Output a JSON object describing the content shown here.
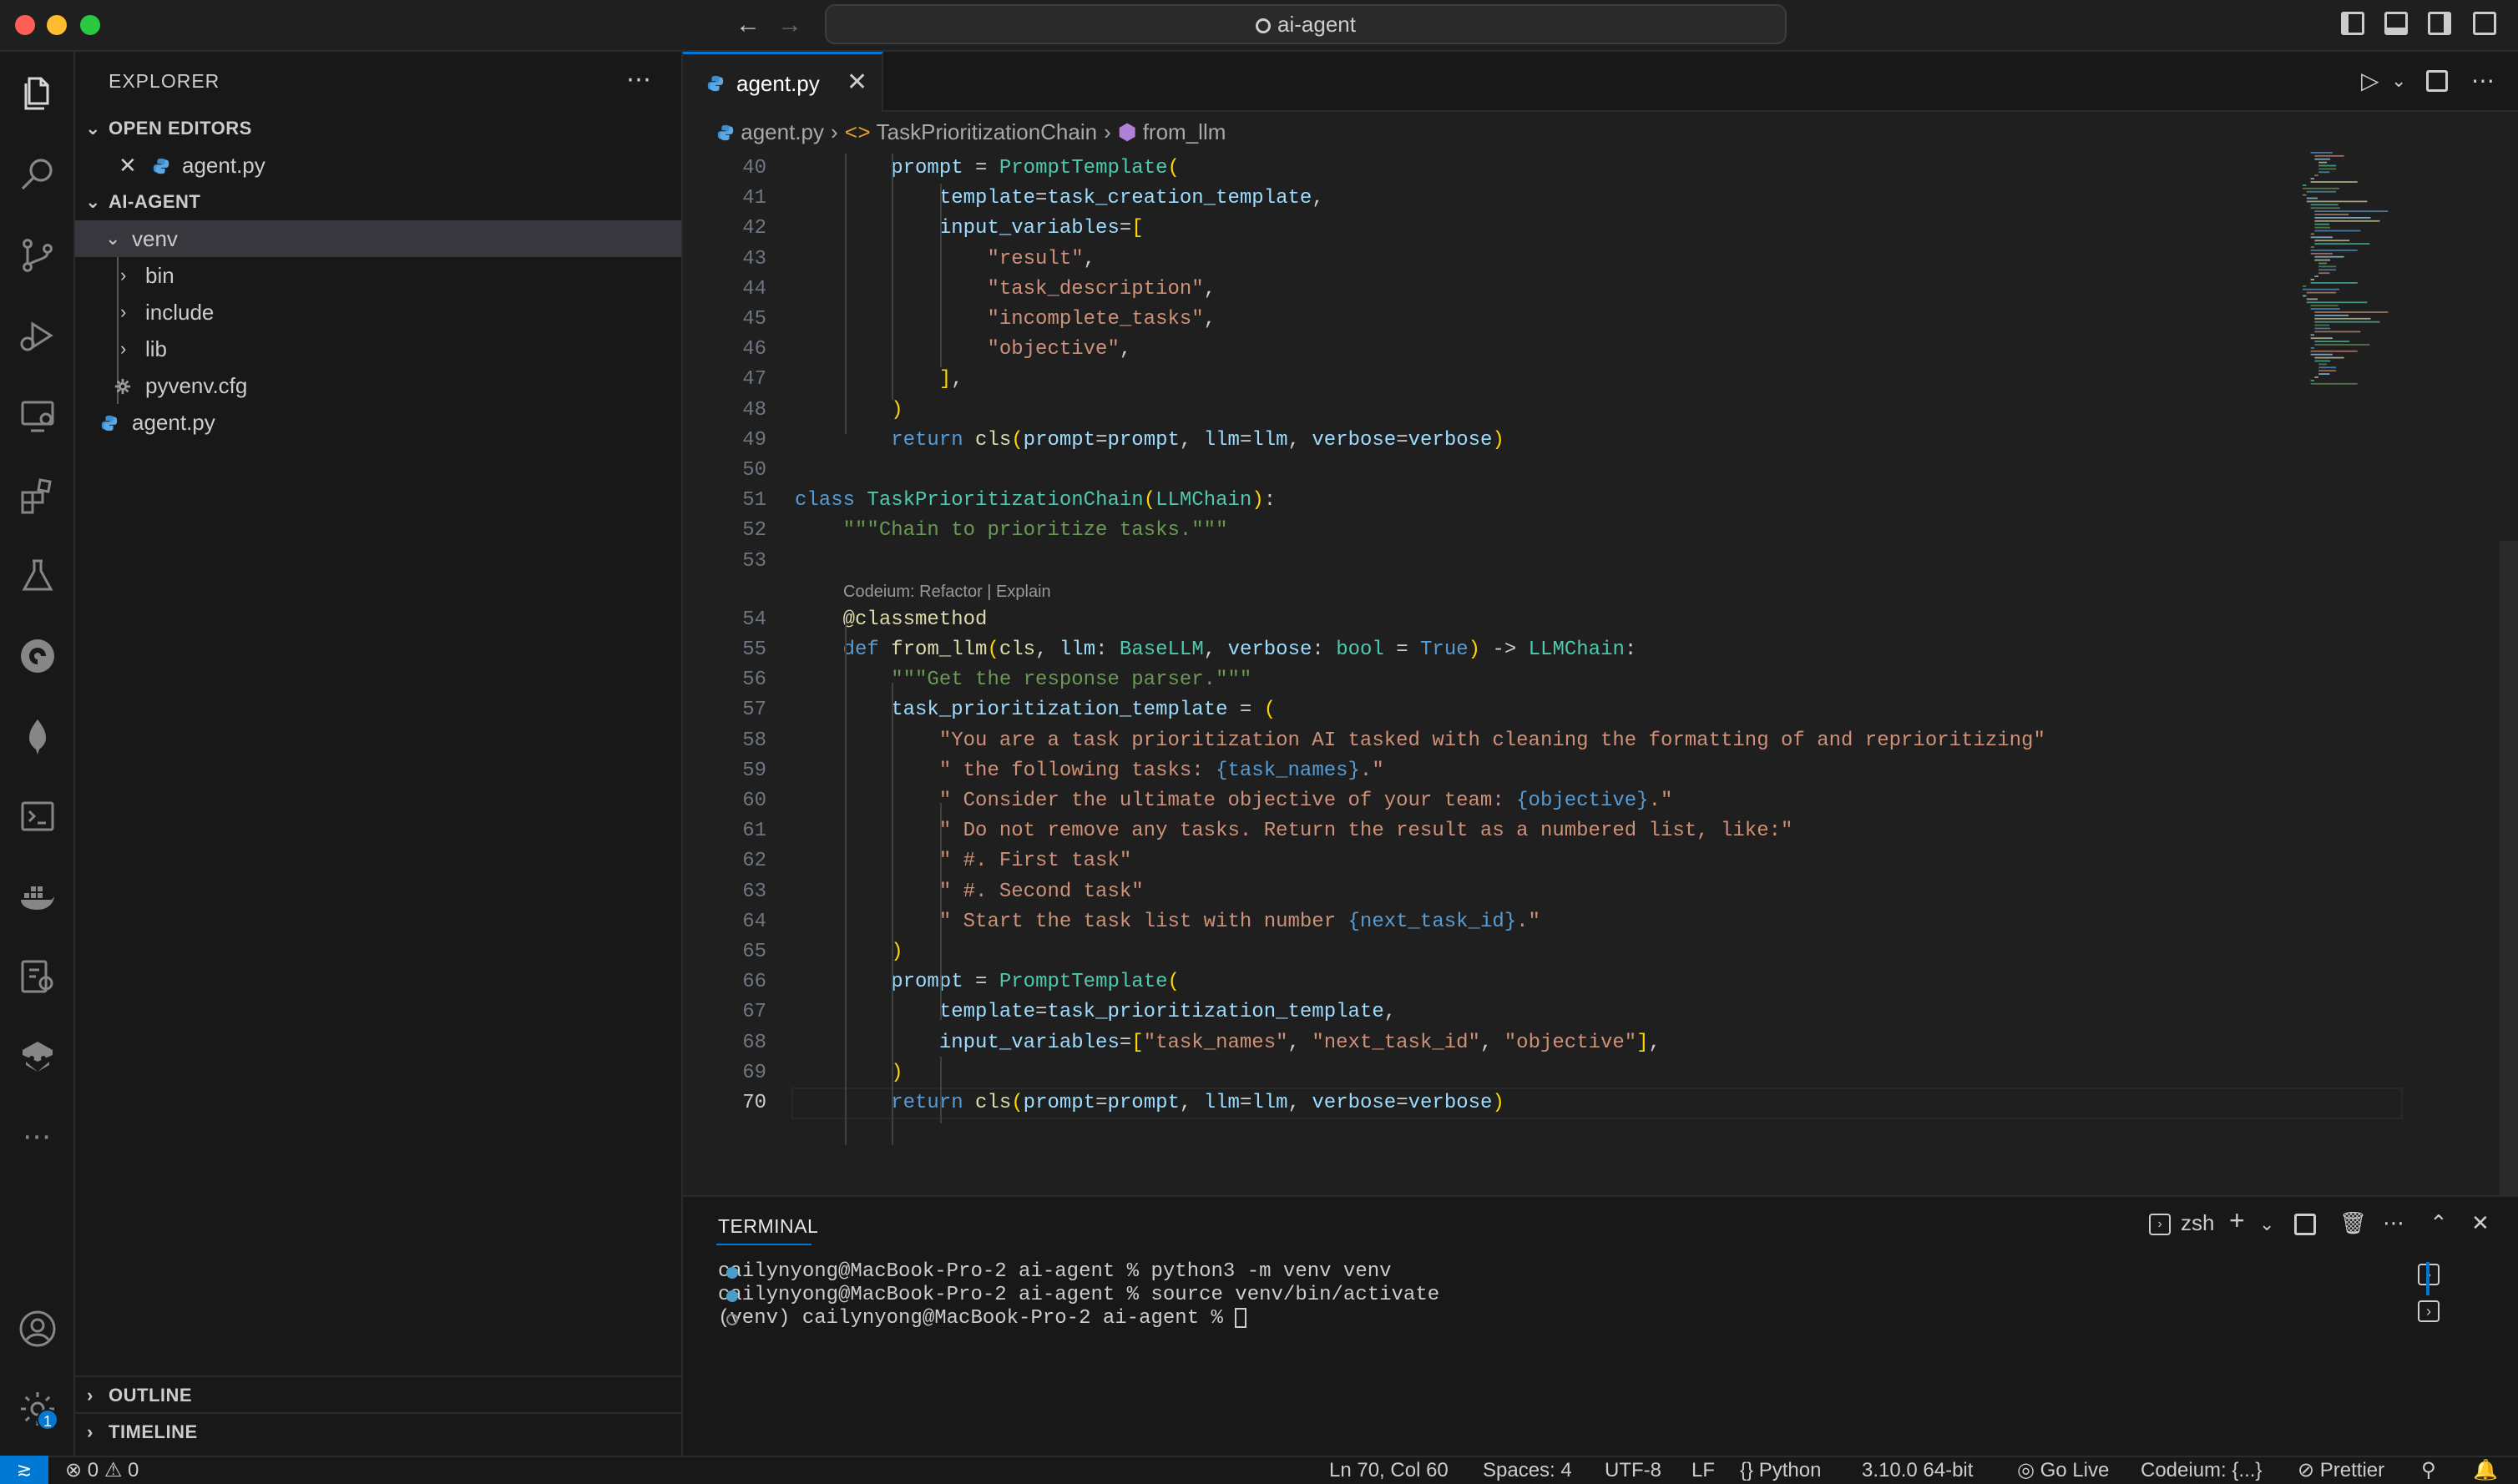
{
  "window": {
    "title": "ai-agent",
    "traffic_colors": {
      "close": "#ff5f57",
      "minimize": "#febc2e",
      "zoom": "#28c840"
    }
  },
  "explorer": {
    "title": "EXPLORER",
    "open_editors": {
      "header": "OPEN EDITORS",
      "items": [
        {
          "name": "agent.py"
        }
      ]
    },
    "project": {
      "header": "AI-AGENT",
      "folder_venv": "venv",
      "folder_bin": "bin",
      "folder_include": "include",
      "folder_lib": "lib",
      "file_pyvenv": "pyvenv.cfg",
      "file_agent": "agent.py"
    },
    "outline": "OUTLINE",
    "timeline": "TIMELINE"
  },
  "editor": {
    "tab": "agent.py",
    "breadcrumb": {
      "file": "agent.py",
      "class": "TaskPrioritizationChain",
      "method": "from_llm"
    },
    "codelens": "Codeium: Refactor | Explain",
    "current_line": 70,
    "lines": [
      {
        "n": "40",
        "t": "        prompt = PromptTemplate("
      },
      {
        "n": "41",
        "t": "            template=task_creation_template,"
      },
      {
        "n": "42",
        "t": "            input_variables=["
      },
      {
        "n": "43",
        "t": "                \"result\","
      },
      {
        "n": "44",
        "t": "                \"task_description\","
      },
      {
        "n": "45",
        "t": "                \"incomplete_tasks\","
      },
      {
        "n": "46",
        "t": "                \"objective\","
      },
      {
        "n": "47",
        "t": "            ],"
      },
      {
        "n": "48",
        "t": "        )"
      },
      {
        "n": "49",
        "t": "        return cls(prompt=prompt, llm=llm, verbose=verbose)"
      },
      {
        "n": "50",
        "t": ""
      },
      {
        "n": "51",
        "t": "class TaskPrioritizationChain(LLMChain):"
      },
      {
        "n": "52",
        "t": "    \"\"\"Chain to prioritize tasks.\"\"\""
      },
      {
        "n": "53",
        "t": ""
      },
      {
        "n": "54",
        "t": "    @classmethod"
      },
      {
        "n": "55",
        "t": "    def from_llm(cls, llm: BaseLLM, verbose: bool = True) -> LLMChain:"
      },
      {
        "n": "56",
        "t": "        \"\"\"Get the response parser.\"\"\""
      },
      {
        "n": "57",
        "t": "        task_prioritization_template = ("
      },
      {
        "n": "58",
        "t": "            \"You are a task prioritization AI tasked with cleaning the formatting of and reprioritizing\""
      },
      {
        "n": "59",
        "t": "            \" the following tasks: {task_names}.\""
      },
      {
        "n": "60",
        "t": "            \" Consider the ultimate objective of your team: {objective}.\""
      },
      {
        "n": "61",
        "t": "            \" Do not remove any tasks. Return the result as a numbered list, like:\""
      },
      {
        "n": "62",
        "t": "            \" #. First task\""
      },
      {
        "n": "63",
        "t": "            \" #. Second task\""
      },
      {
        "n": "64",
        "t": "            \" Start the task list with number {next_task_id}.\""
      },
      {
        "n": "65",
        "t": "        )"
      },
      {
        "n": "66",
        "t": "        prompt = PromptTemplate("
      },
      {
        "n": "67",
        "t": "            template=task_prioritization_template,"
      },
      {
        "n": "68",
        "t": "            input_variables=[\"task_names\", \"next_task_id\", \"objective\"],"
      },
      {
        "n": "69",
        "t": "        )"
      },
      {
        "n": "70",
        "t": "        return cls(prompt=prompt, llm=llm, verbose=verbose)"
      }
    ]
  },
  "panel": {
    "title": "TERMINAL",
    "shell": "zsh",
    "lines": [
      "cailynyong@MacBook-Pro-2 ai-agent % python3 -m venv venv",
      "cailynyong@MacBook-Pro-2 ai-agent % source venv/bin/activate",
      "(venv) cailynyong@MacBook-Pro-2 ai-agent % "
    ]
  },
  "status": {
    "errors": "0",
    "warnings": "0",
    "position": "Ln 70, Col 60",
    "spaces": "Spaces: 4",
    "encoding": "UTF-8",
    "eol": "LF",
    "language": "Python",
    "interpreter": "3.10.0 64-bit",
    "golive": "Go Live",
    "codeium": "Codeium: {...}",
    "prettier": "Prettier",
    "settings_badge": "1"
  }
}
